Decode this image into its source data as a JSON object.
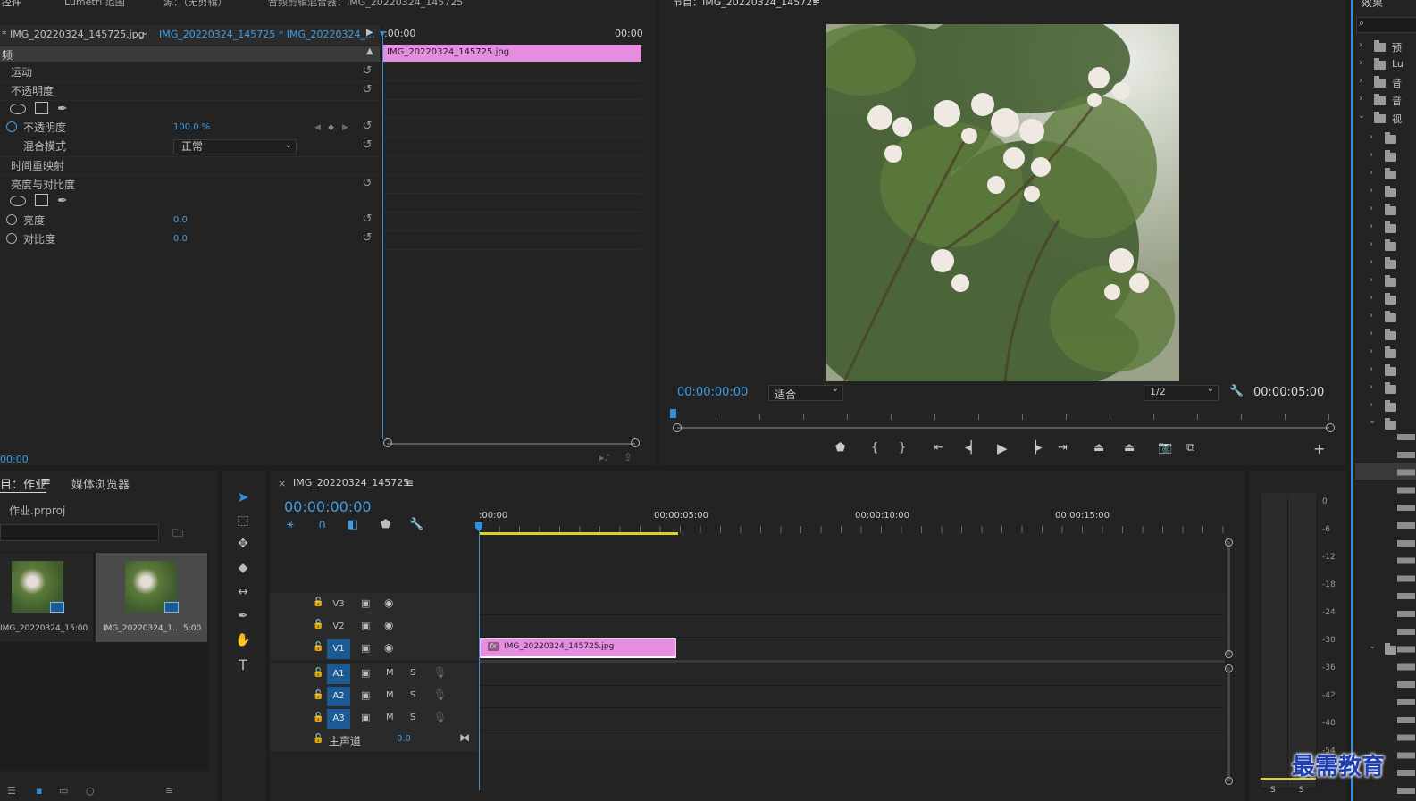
{
  "effect_controls": {
    "tabs": [
      "控件",
      "Lumetri 范围",
      "源：（无剪辑）",
      "音频剪辑混合器：IMG_20220324_145725"
    ],
    "source_clip": "* IMG_20220324_145725.jpg",
    "sequence_clip": "IMG_20220324_145725 * IMG_20220324_...",
    "section_header": "频",
    "motion": "运动",
    "opacity_group": "不透明度",
    "opacity_param": "不透明度",
    "opacity_value": "100.0 %",
    "blend_mode_label": "混合模式",
    "blend_mode_value": "正常",
    "time_remap": "时间重映射",
    "brightness_contrast": "亮度与对比度",
    "brightness_label": "亮度",
    "brightness_value": "0.0",
    "contrast_label": "对比度",
    "contrast_value": "0.0",
    "timecode": "00:00",
    "mini_timeline_start": ":00:00",
    "mini_timeline_end": "00:00",
    "clip_name": "IMG_20220324_145725.jpg"
  },
  "program_monitor": {
    "title": "节目：IMG_20220324_145725",
    "current_time": "00:00:00:00",
    "fit_label": "适合",
    "resolution": "1/2",
    "duration": "00:00:05:00"
  },
  "project": {
    "tabs": [
      "目：作业",
      "媒体浏览器"
    ],
    "project_file": "作业.prproj",
    "items": [
      {
        "name": "IMG_20220324_1...",
        "duration": "5:00"
      },
      {
        "name": "IMG_20220324_1...",
        "duration": "5:00"
      }
    ]
  },
  "timeline": {
    "sequence_name": "IMG_20220324_145725",
    "timecode": "00:00:00:00",
    "ruler": [
      ":00:00",
      "00:00:05:00",
      "00:00:10:00",
      "00:00:15:00"
    ],
    "video_tracks": [
      "V3",
      "V2",
      "V1"
    ],
    "audio_tracks": [
      "A1",
      "A2",
      "A3"
    ],
    "mute_label": "M",
    "solo_label": "S",
    "master_label": "主声道",
    "master_value": "0.0",
    "clip_fx": "fx",
    "clip_name": "IMG_20220324_145725.jpg"
  },
  "audio_meter": {
    "scale": [
      "0",
      "-6",
      "-12",
      "-18",
      "-24",
      "-30",
      "-36",
      "-42",
      "-48",
      "-54"
    ],
    "channels": [
      "S",
      "S"
    ]
  },
  "effects_panel": {
    "title": "效果",
    "items": [
      "预",
      "Lu",
      "音",
      "音",
      "视"
    ]
  },
  "watermark": "最需教育",
  "colors": {
    "accent_blue": "#3f9ee6",
    "clip_pink": "#e58ee0",
    "selected_track": "#1c5a96"
  }
}
